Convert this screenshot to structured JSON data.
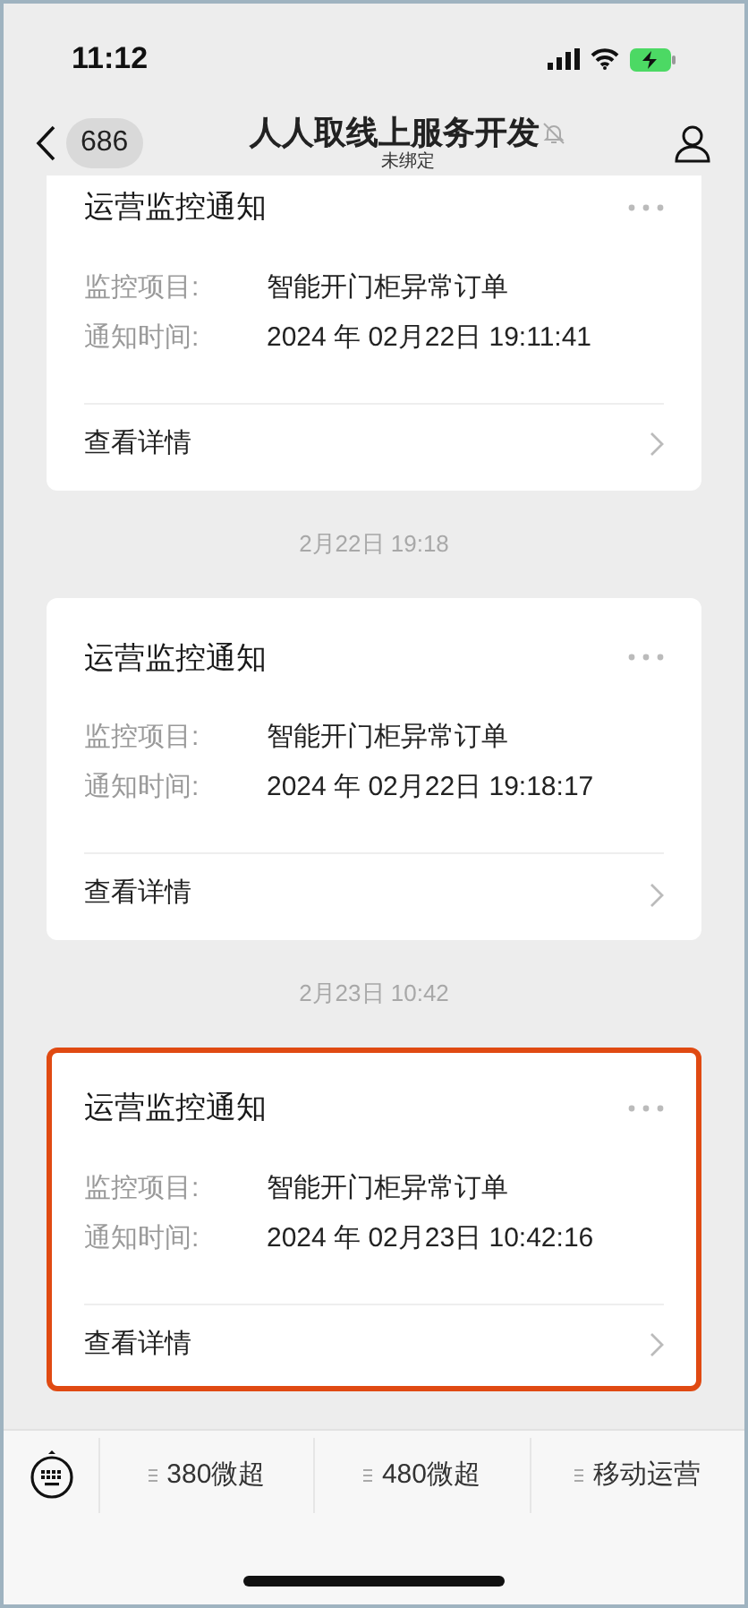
{
  "status_bar": {
    "time": "11:12"
  },
  "nav": {
    "back_count": "686",
    "title": "人人取线上服务开发",
    "muted": true,
    "subtitle": "未绑定"
  },
  "messages": [
    {
      "title": "运营监控通知",
      "fields": [
        {
          "label": "监控项目:",
          "value": "智能开门柜异常订单"
        },
        {
          "label": "通知时间:",
          "value": "2024 年 02月22日 19:11:41"
        }
      ],
      "link": "查看详情",
      "highlighted": false
    },
    {
      "timestamp": "2月22日 19:18",
      "title": "运营监控通知",
      "fields": [
        {
          "label": "监控项目:",
          "value": "智能开门柜异常订单"
        },
        {
          "label": "通知时间:",
          "value": "2024 年 02月22日 19:18:17"
        }
      ],
      "link": "查看详情",
      "highlighted": false
    },
    {
      "timestamp": "2月23日 10:42",
      "title": "运营监控通知",
      "fields": [
        {
          "label": "监控项目:",
          "value": "智能开门柜异常订单"
        },
        {
          "label": "通知时间:",
          "value": "2024 年 02月23日 10:42:16"
        }
      ],
      "link": "查看详情",
      "highlighted": true
    }
  ],
  "menu": [
    "380微超",
    "480微超",
    "移动运营"
  ]
}
